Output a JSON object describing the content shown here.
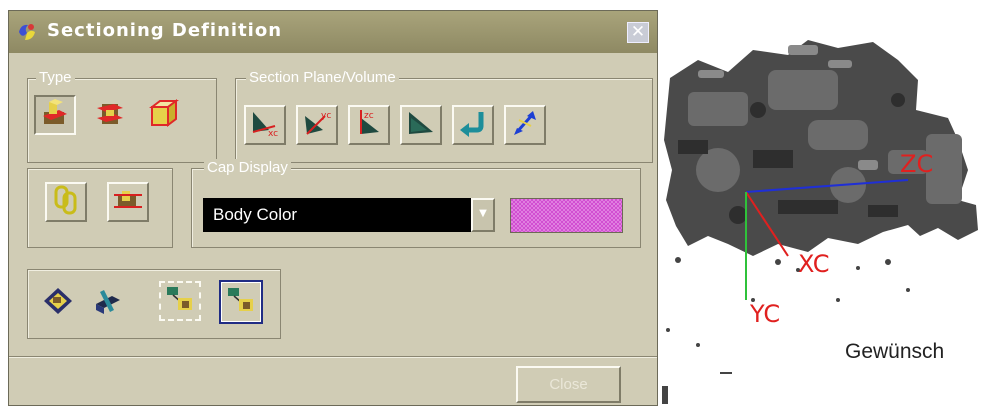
{
  "dialog": {
    "title": "Sectioning Definition",
    "close_button_glyph": "✕",
    "type_group": {
      "label": "Type",
      "buttons": [
        {
          "icon": "section-planes-icon",
          "state": "pressed"
        },
        {
          "icon": "section-box-icon",
          "state": "normal"
        },
        {
          "icon": "section-volume-icon",
          "state": "normal"
        }
      ]
    },
    "plane_group": {
      "label": "Section Plane/Volume",
      "buttons": [
        {
          "icon": "plane-xc-icon",
          "axis": "xc"
        },
        {
          "icon": "plane-yc-icon",
          "axis": "yc"
        },
        {
          "icon": "plane-zc-icon",
          "axis": "zc"
        },
        {
          "icon": "plane-dynamic-icon"
        },
        {
          "icon": "reverse-direction-icon"
        },
        {
          "icon": "flip-normal-icon"
        }
      ]
    },
    "link_group": {
      "buttons": [
        {
          "icon": "chain-link-icon"
        },
        {
          "icon": "section-clip-icon"
        }
      ]
    },
    "cap_group": {
      "label": "Cap Display",
      "selected": "Body Color",
      "swatch_color": "#d14ed1"
    },
    "bottom_tools": [
      {
        "icon": "cap-view-icon",
        "state": "normal"
      },
      {
        "icon": "clip-solid-icon",
        "state": "normal"
      },
      {
        "icon": "section-curves-icon",
        "state": "dashed"
      },
      {
        "icon": "section-assembly-icon",
        "state": "boxed"
      }
    ],
    "close_label": "Close"
  },
  "viewport": {
    "axes": {
      "x": "XC",
      "y": "YC",
      "z": "ZC"
    },
    "caption": "Gewünsch"
  },
  "colors": {
    "dialog_bg": "#d0ccb5",
    "titlebar": "#9a966e",
    "axis_label": "#e0201f",
    "axis_x": "#e0201f",
    "axis_y": "#2fc23a",
    "axis_z": "#1f2fd6"
  }
}
